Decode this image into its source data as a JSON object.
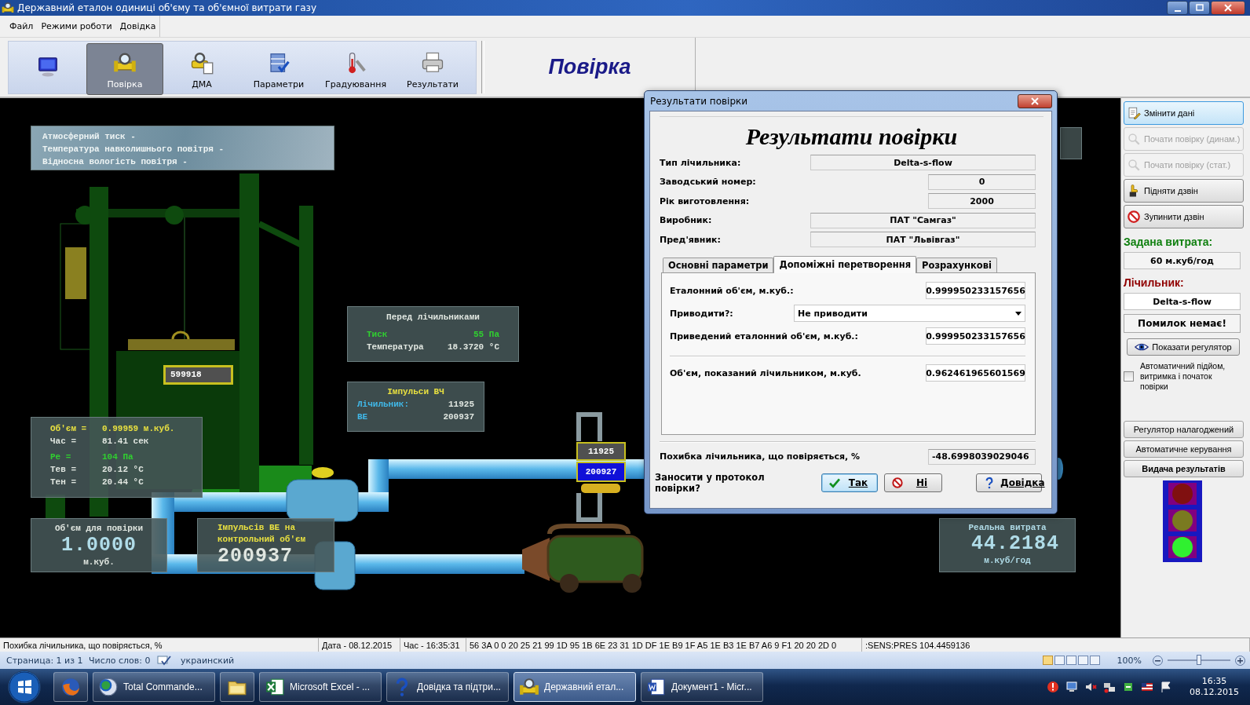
{
  "window": {
    "title": "Державний еталон одиниці об'єму та об'ємної витрати газу"
  },
  "menu": [
    {
      "label": "Файл"
    },
    {
      "label": "Режими роботи"
    },
    {
      "label": "Довідка"
    }
  ],
  "toolbar": [
    {
      "kind": "monitor",
      "selected": false
    },
    {
      "kind": "pipe",
      "label": "Повірка",
      "selected": true
    },
    {
      "kind": "pipe-doc",
      "label": "ДМА",
      "selected": false
    },
    {
      "kind": "database",
      "label": "Параметри",
      "selected": false
    },
    {
      "kind": "thermometer",
      "label": "Градуювання",
      "selected": false
    },
    {
      "kind": "printer",
      "label": "Результати",
      "selected": false
    }
  ],
  "mode_title": "Повірка",
  "ambient_panel": {
    "rows": [
      {
        "label": "Атмосферний тиск -"
      },
      {
        "label": "Температура навколишнього повітря -"
      },
      {
        "label": "Відносна вологість повітря -"
      }
    ]
  },
  "bell_counter": "599918",
  "before_meters": {
    "title": "Перед лічильниками",
    "rows": [
      {
        "label": "Тиск",
        "value": "55 Па",
        "color": "#30d030"
      },
      {
        "label": "Температура",
        "value": "18.3720 °C",
        "color": "#e0e6e0"
      }
    ]
  },
  "pulses_hf": {
    "title": "Імпульси ВЧ",
    "rows": [
      {
        "label": "Лічильник:",
        "value": "11925"
      },
      {
        "label": "ВЕ",
        "value": "200937"
      }
    ]
  },
  "volume_panel": {
    "rows": [
      {
        "label": "Об'єм =",
        "value": "0.99959 м.куб.",
        "color": "#e8e040"
      },
      {
        "label": "Час =",
        "value": "81.41 сек",
        "color": "#e0e6e0"
      },
      {
        "label": "Ре =",
        "value": "104 Па",
        "color": "#30d030"
      },
      {
        "label": "Тев =",
        "value": "20.12 °C",
        "color": "#e0e6e0"
      },
      {
        "label": "Тен =",
        "value": "20.44 °C",
        "color": "#e0e6e0"
      }
    ]
  },
  "test_volume": {
    "title": "Об'єм для повірки",
    "value": "1.0000",
    "unit": "м.куб."
  },
  "pulses_volume": {
    "title": "Імпульсів ВЕ на контрольний об'єм",
    "value": "200937"
  },
  "meter_display": {
    "hf": "11925",
    "ve": "200927"
  },
  "real_flow": {
    "title": "Реальна витрата",
    "value": "44.2184",
    "unit": "м.куб/год"
  },
  "dialog": {
    "title": "Результати повірки",
    "heading": "Результати повірки",
    "fields": [
      {
        "label": "Тип лічильника:",
        "value": "Delta-s-flow",
        "kind": "wide"
      },
      {
        "label": "Заводський номер:",
        "value": "0",
        "kind": "narrow"
      },
      {
        "label": "Рік виготовлення:",
        "value": "2000",
        "kind": "narrow"
      },
      {
        "label": "Виробник:",
        "value": "ПАТ \"Самгаз\"",
        "kind": "wide"
      },
      {
        "label": "Пред'явник:",
        "value": "ПАТ \"Львівгаз\"",
        "kind": "wide"
      }
    ],
    "tabs": [
      {
        "label": "Основні параметри",
        "selected": false
      },
      {
        "label": "Допоміжні перетворення",
        "selected": true
      },
      {
        "label": "Розрахункові",
        "selected": false
      }
    ],
    "tab_fields": [
      {
        "label": "Еталонний об'єм, м.куб.:",
        "value": "0.999950233157656",
        "kind": "field"
      },
      {
        "label": "Приводити?:",
        "value": "Не приводити",
        "kind": "dropdown"
      },
      {
        "label": "Приведений еталонний об'єм, м.куб.:",
        "value": "0.999950233157656",
        "kind": "field"
      },
      {
        "label": "Об'єм, показаний лічильником, м.куб.",
        "value": "0.962461965601569",
        "kind": "field"
      }
    ],
    "error": {
      "label": "Похибка лічильника, що повіряється, %",
      "value": "-48.6998039029046"
    },
    "question": "Заносити у протокол повірки?",
    "buttons": [
      {
        "label": "Так",
        "kind": "ok",
        "focused": true
      },
      {
        "label": "Ні",
        "kind": "cancel",
        "focused": false
      },
      {
        "label": "Довідка",
        "kind": "help",
        "focused": false
      }
    ]
  },
  "side_panel": {
    "buttons": [
      {
        "kind": "edit",
        "label": "Змінити дані",
        "disabled": false,
        "focused": true
      },
      {
        "kind": "magnifier",
        "label": "Почати повірку (динам.)",
        "disabled": true,
        "focused": false
      },
      {
        "kind": "magnifier",
        "label": "Почати повірку (стат.)",
        "disabled": true,
        "focused": false
      },
      {
        "kind": "hand",
        "label": "Підняти дзвін",
        "disabled": false,
        "focused": false
      },
      {
        "kind": "stop",
        "label": "Зупинити дзвін",
        "disabled": false,
        "focused": false
      }
    ],
    "flow_label": "Задана витрата:",
    "flow_value": "60 м.куб/год",
    "meter_label": "Лічильник:",
    "meter_value": "Delta-s-flow",
    "status": "Помилок немає!",
    "regulator_button": "Показати регулятор",
    "auto_checkbox": {
      "label": "Автоматичний підйом, витримка і початок повірки",
      "checked": false
    },
    "lower_buttons": [
      {
        "label": "Регулятор налагоджений",
        "bold": false
      },
      {
        "label": "Автоматичне керування",
        "bold": false
      },
      {
        "label": "Видача результатів",
        "bold": true
      }
    ],
    "traffic_light": [
      {
        "on": false
      },
      {
        "on": false
      },
      {
        "on": true
      }
    ]
  },
  "status_bar": [
    "Похибка лічильника, що повіряється, %",
    "Дата - 08.12.2015",
    "Час - 16:35:31",
    "56 3A 0 0 20 25 21 99 1D 95 1B 6E 23 31 1D DF 1E B9 1F A5 1E B3 1E B7 A6 9 F1 20 20 2D 0",
    ":SENS:PRES 104.4459136"
  ],
  "word_bar": {
    "page": "Страница: 1 из 1",
    "words": "Число слов: 0",
    "language": "украинский",
    "zoom": "100%",
    "zoom_slider": {
      "level": 0.5
    }
  },
  "taskbar": {
    "tasks": [
      {
        "kind": "firefox",
        "selected": false
      },
      {
        "kind": "globe",
        "label": "Total Commande...",
        "selected": false
      },
      {
        "kind": "folder",
        "selected": false
      },
      {
        "kind": "excel",
        "label": "Microsoft Excel - ...",
        "selected": false
      },
      {
        "kind": "help",
        "label": "Довідка та підтри...",
        "selected": false
      },
      {
        "kind": "pipe",
        "label": "Державний етал...",
        "selected": true
      },
      {
        "kind": "word",
        "label": "Документ1 - Micr...",
        "selected": false
      }
    ],
    "time": "16:35",
    "date": "08.12.2015"
  }
}
